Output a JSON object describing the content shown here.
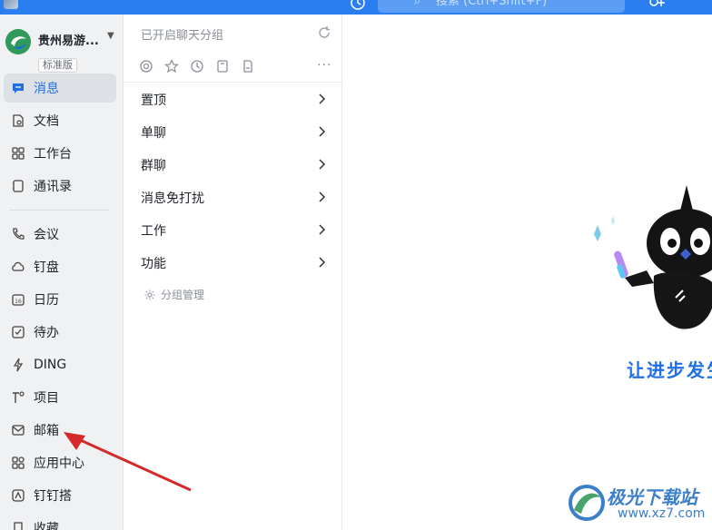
{
  "topbar": {
    "search_placeholder": "搜索 (Ctrl+Shift+F)",
    "accent": "#2a7ef0"
  },
  "org": {
    "name": "贵州易游...",
    "edition": "标准版"
  },
  "sidebar": {
    "items": [
      {
        "label": "消息",
        "icon": "message-icon",
        "active": true
      },
      {
        "label": "文档",
        "icon": "document-icon"
      },
      {
        "label": "工作台",
        "icon": "workbench-icon"
      },
      {
        "label": "通讯录",
        "icon": "contacts-icon"
      },
      {
        "label": "会议",
        "icon": "phone-icon"
      },
      {
        "label": "钉盘",
        "icon": "cloud-icon"
      },
      {
        "label": "日历",
        "icon": "calendar-icon"
      },
      {
        "label": "待办",
        "icon": "checkbox-icon"
      },
      {
        "label": "DING",
        "icon": "lightning-icon"
      },
      {
        "label": "项目",
        "icon": "project-icon"
      },
      {
        "label": "邮箱",
        "icon": "mail-icon"
      },
      {
        "label": "应用中心",
        "icon": "apps-icon"
      },
      {
        "label": "钉钉搭",
        "icon": "builder-icon"
      },
      {
        "label": "收藏",
        "icon": "bookmark-icon"
      }
    ]
  },
  "middle": {
    "title": "已开启聊天分组",
    "more": "···",
    "groups": [
      {
        "label": "置顶"
      },
      {
        "label": "单聊"
      },
      {
        "label": "群聊"
      },
      {
        "label": "消息免打扰"
      },
      {
        "label": "工作"
      },
      {
        "label": "功能"
      }
    ],
    "manage_label": "分组管理"
  },
  "content": {
    "slogan": "让进步发生"
  },
  "watermark": {
    "name": "极光下载站",
    "url": "www.xz7.com"
  }
}
